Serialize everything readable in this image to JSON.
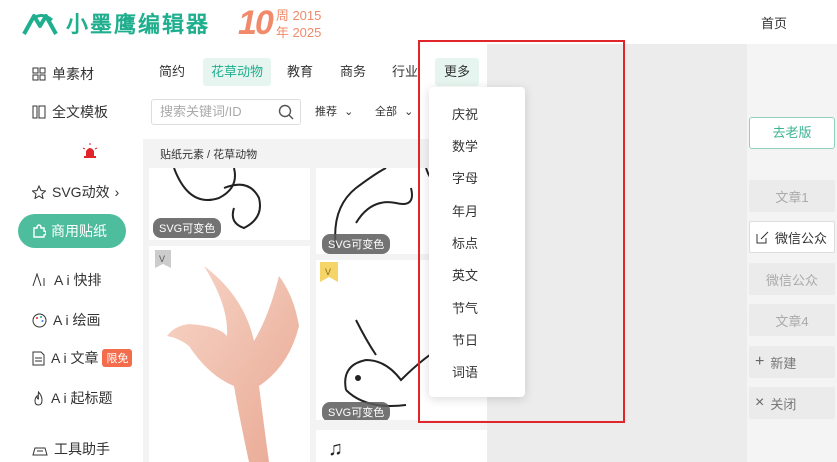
{
  "header": {
    "logo_text": "小墨鹰编辑器",
    "anniv_number": "10",
    "anniv_line1": "周 2015",
    "anniv_line2": "年 2025",
    "home_link": "首页",
    "brand_color": "#1fae8e",
    "anniv_color": "#f08a6a"
  },
  "leftnav": {
    "items": [
      {
        "label": "单素材",
        "icon": "grid-icon"
      },
      {
        "label": "全文模板",
        "icon": "template-icon"
      },
      {
        "label": "SVG动效",
        "icon": "star-icon",
        "suffix": "›"
      },
      {
        "label": "商用贴纸",
        "icon": "puzzle-icon",
        "active": true
      },
      {
        "label": "A i 快排",
        "icon": "ai-icon"
      },
      {
        "label": "A i 绘画",
        "icon": "palette-icon"
      },
      {
        "label": "A i 文章",
        "icon": "doc-icon",
        "badge": "限免"
      },
      {
        "label": "A i 起标题",
        "icon": "fire-icon"
      },
      {
        "label": "工具助手",
        "icon": "tool-icon"
      }
    ],
    "active_color": "#4dbd9d"
  },
  "tabs": [
    "简约",
    "花草动物",
    "教育",
    "商务",
    "行业",
    "更多"
  ],
  "active_tab": "花草动物",
  "search": {
    "placeholder": "搜索关键词/ID"
  },
  "filters": {
    "sort": "推荐",
    "scope": "全部"
  },
  "breadcrumb": "贴纸元素 / 花草动物",
  "cards": {
    "tag": "SVG可变色"
  },
  "dropdown": {
    "items": [
      "庆祝",
      "数学",
      "字母",
      "年月",
      "标点",
      "英文",
      "节气",
      "节日",
      "词语"
    ]
  },
  "right": {
    "old_version": "去老版",
    "articles": [
      "文章1",
      "微信公众",
      "微信公众",
      "文章4"
    ],
    "current_index": 1,
    "new_label": "新建",
    "close_label": "关闭"
  }
}
